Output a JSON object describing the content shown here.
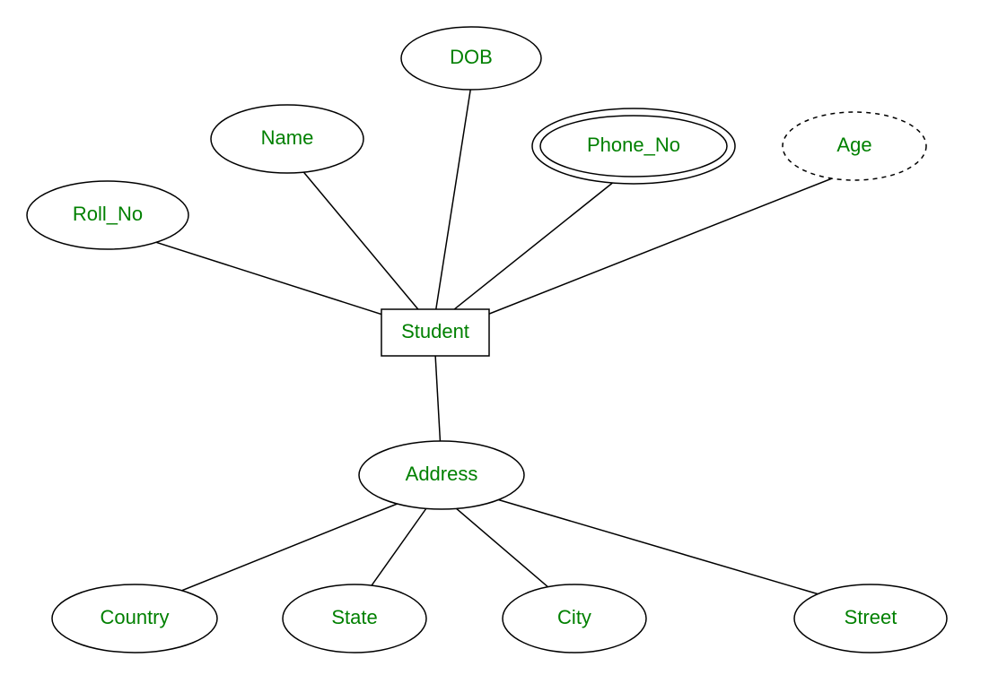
{
  "entity": {
    "student": "Student"
  },
  "attributes": {
    "roll_no": "Roll_No",
    "name": "Name",
    "dob": "DOB",
    "phone_no": "Phone_No",
    "age": "Age",
    "address": "Address",
    "country": "Country",
    "state": "State",
    "city": "City",
    "street": "Street"
  },
  "colors": {
    "text": "#008000",
    "stroke": "#000000",
    "background": "#ffffff"
  }
}
